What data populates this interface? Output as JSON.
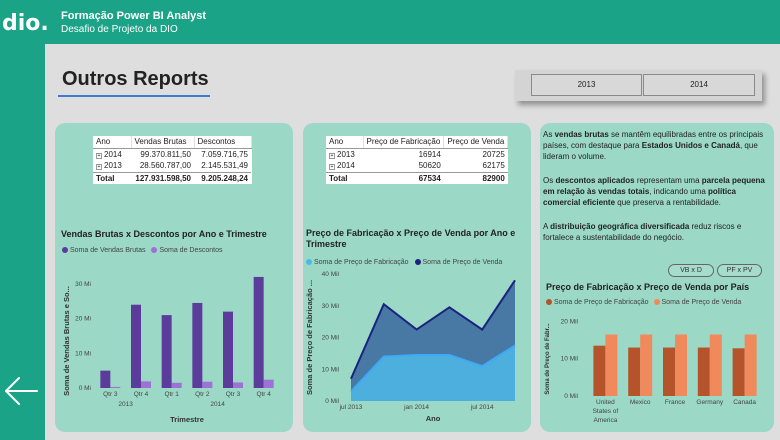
{
  "header": {
    "logo": "dio.",
    "title": "Formação Power BI Analyst",
    "subtitle": "Desafio de Projeto da DIO"
  },
  "page": {
    "title": "Outros Reports"
  },
  "slicer": {
    "years": [
      "2013",
      "2014"
    ]
  },
  "table1": {
    "headers": [
      "Ano",
      "Vendas Brutas",
      "Descontos"
    ],
    "rows": [
      {
        "ano": "2014",
        "vendas": "99.370.811,50",
        "descontos": "7.059.716,75"
      },
      {
        "ano": "2013",
        "vendas": "28.560.787,00",
        "descontos": "2.145.531,49"
      }
    ],
    "total": {
      "label": "Total",
      "vendas": "127.931.598,50",
      "descontos": "9.205.248,24"
    }
  },
  "table2": {
    "headers": [
      "Ano",
      "Preço de Fabricação",
      "Preço de Venda"
    ],
    "rows": [
      {
        "ano": "2013",
        "fab": "16914",
        "venda": "20725"
      },
      {
        "ano": "2014",
        "fab": "50620",
        "venda": "62175"
      }
    ],
    "total": {
      "label": "Total",
      "fab": "67534",
      "venda": "82900"
    }
  },
  "description": {
    "p1": [
      "As ",
      "vendas brutas",
      " se mantêm equilibradas entre os principais países, com destaque para ",
      "Estados Unidos e Canadá",
      ", que lideram o volume."
    ],
    "p2": [
      "Os ",
      "descontos aplicados",
      " representam uma ",
      "parcela pequena em relação às vendas totais",
      ", indicando uma ",
      "política comercial eficiente",
      " que preserva a rentabilidade."
    ],
    "p3": [
      " A ",
      "distribuição geográfica diversificada",
      " reduz riscos e fortalece a sustentabilidade do negócio."
    ]
  },
  "pills": [
    "VB x D",
    "PF x PV"
  ],
  "colors": {
    "teal": "#1aa386",
    "card": "#9bd8c6",
    "purple_dark": "#5b3c9b",
    "purple_light": "#9d72d6",
    "area_light": "#4db8e8",
    "area_dark": "#1a237e",
    "bar_dark": "#b5532b",
    "bar_light": "#f08a5d"
  },
  "chart_data": [
    {
      "type": "bar",
      "title": "Vendas Brutas x Descontos por Ano e Trimestre",
      "xlabel": "Trimestre",
      "ylabel": "Soma de Vendas Brutas e So...",
      "categories": [
        "Qtr 3",
        "Qtr 4",
        "Qtr 1",
        "Qtr 2",
        "Qtr 3",
        "Qtr 4"
      ],
      "groups": [
        {
          "label": "2013",
          "span": [
            0,
            1
          ]
        },
        {
          "label": "2014",
          "span": [
            2,
            5
          ]
        }
      ],
      "series": [
        {
          "name": "Soma de Vendas Brutas",
          "values": [
            5,
            24,
            21,
            24.5,
            22,
            32
          ]
        },
        {
          "name": "Soma de Descontos",
          "values": [
            0.3,
            1.9,
            1.5,
            1.8,
            1.6,
            2.4
          ]
        }
      ],
      "yticks": [
        "0 Mi",
        "10 Mi",
        "20 Mi",
        "30 Mi"
      ],
      "ylim": [
        0,
        34
      ]
    },
    {
      "type": "area",
      "title": "Preço de Fabricação x Preço de Venda por Ano e Trimestre",
      "xlabel": "Ano",
      "ylabel": "Soma de Preço de Fabricação ...",
      "x": [
        "2013-Q3",
        "2013-Q4",
        "2014-Q1",
        "2014-Q2",
        "2014-Q3",
        "2014-Q4"
      ],
      "xticks": [
        "jul 2013",
        "jan 2014",
        "jul 2014"
      ],
      "series": [
        {
          "name": "Soma de Preço de Fabricação",
          "values": [
            3,
            14,
            14.5,
            14.5,
            11,
            17.5
          ]
        },
        {
          "name": "Soma de Preço de Venda",
          "values": [
            7,
            30.5,
            22.5,
            29.5,
            22.5,
            38
          ]
        }
      ],
      "yticks": [
        "0 Mil",
        "10 Mil",
        "20 Mil",
        "30 Mil",
        "40 Mil"
      ],
      "ylim": [
        0,
        40
      ]
    },
    {
      "type": "bar",
      "title": "Preço de Fabricação x Preço de Venda por País",
      "ylabel": "Soma de Preço de Fabr...",
      "categories": [
        "United States of America",
        "Mexico",
        "France",
        "Germany",
        "Canada"
      ],
      "category_lines": [
        [
          "United",
          "States of",
          "America"
        ],
        [
          "Mexico"
        ],
        [
          "France"
        ],
        [
          "Germany"
        ],
        [
          "Canada"
        ]
      ],
      "series": [
        {
          "name": "Soma de Preço de Fabricação",
          "values": [
            13.5,
            13,
            13,
            13,
            12.8
          ]
        },
        {
          "name": "Soma de Preço de Venda",
          "values": [
            16.5,
            16.5,
            16.5,
            16.5,
            16.5
          ]
        }
      ],
      "yticks": [
        "0 Mil",
        "10 Mil",
        "20 Mil"
      ],
      "ylim": [
        0,
        22
      ]
    }
  ]
}
